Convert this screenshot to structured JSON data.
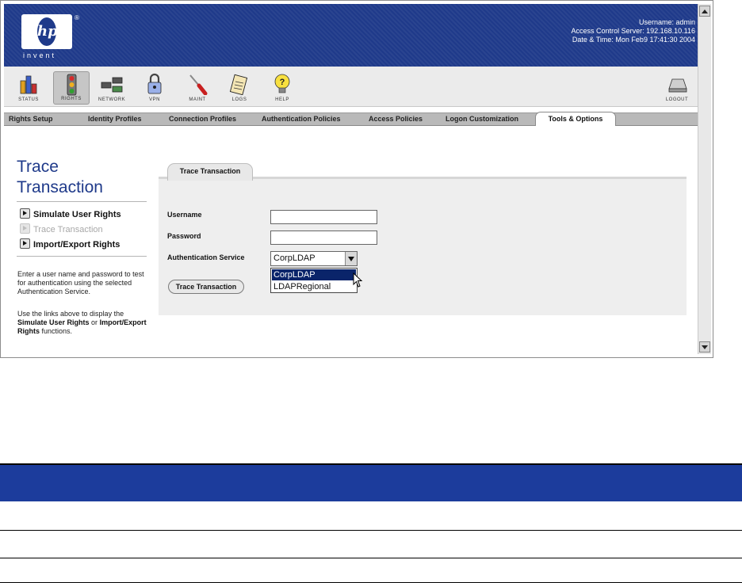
{
  "header": {
    "logo_text": "hp",
    "logo_tagline": "invent",
    "registered_mark": "®",
    "username_label": "Username:",
    "username": "admin",
    "server_label": "Access Control Server:",
    "server": "192.168.10.116",
    "datetime_label": "Date & Time:",
    "datetime": "Mon Feb9 17:41:30 2004",
    "brand_color": "#1f3a8a"
  },
  "toolbar": {
    "items": [
      {
        "label": "STATUS",
        "icon": "status-chart-icon"
      },
      {
        "label": "RIGHTS",
        "icon": "traffic-light-icon",
        "active": true
      },
      {
        "label": "NETWORK",
        "icon": "network-icon"
      },
      {
        "label": "VPN",
        "icon": "padlock-icon"
      },
      {
        "label": "MAINT",
        "icon": "screwdriver-icon"
      },
      {
        "label": "LOGS",
        "icon": "clipboard-icon"
      },
      {
        "label": "HELP",
        "icon": "lightbulb-help-icon"
      },
      {
        "label": "LOGOUT",
        "icon": "logout-keyboard-icon"
      }
    ]
  },
  "nav_tabs": [
    "Rights Setup",
    "Identity Profiles",
    "Connection Profiles",
    "Authentication Policies",
    "Access Policies",
    "Logon Customization",
    "Tools & Options"
  ],
  "active_nav_tab": "Tools & Options",
  "sidebar": {
    "title": "Trace Transaction",
    "links": [
      {
        "label": "Simulate User Rights",
        "active": true
      },
      {
        "label": "Trace Transaction",
        "active": false
      },
      {
        "label": "Import/Export Rights",
        "active": true
      }
    ],
    "description1": "Enter a user name and password to test for authentication using the selected Authentication Service.",
    "description2_prefix": "Use the links above to display the",
    "description2_link1": "Simulate User Rights",
    "description2_or": "or",
    "description2_link2": "Import/Export Rights",
    "description2_suffix": "functions."
  },
  "form": {
    "tab_label": "Trace Transaction",
    "username_label": "Username",
    "username_value": "",
    "password_label": "Password",
    "password_value": "",
    "auth_service_label": "Authentication Service",
    "auth_service_selected": "CorpLDAP",
    "auth_service_options": [
      "CorpLDAP",
      "LDAPRegional"
    ],
    "submit_label": "Trace Transaction"
  },
  "colors": {
    "header_blue": "#1f3a8a",
    "title_blue": "#1f3a8a",
    "table_header_blue": "#1c3c9c",
    "selection_blue": "#0a246a"
  }
}
